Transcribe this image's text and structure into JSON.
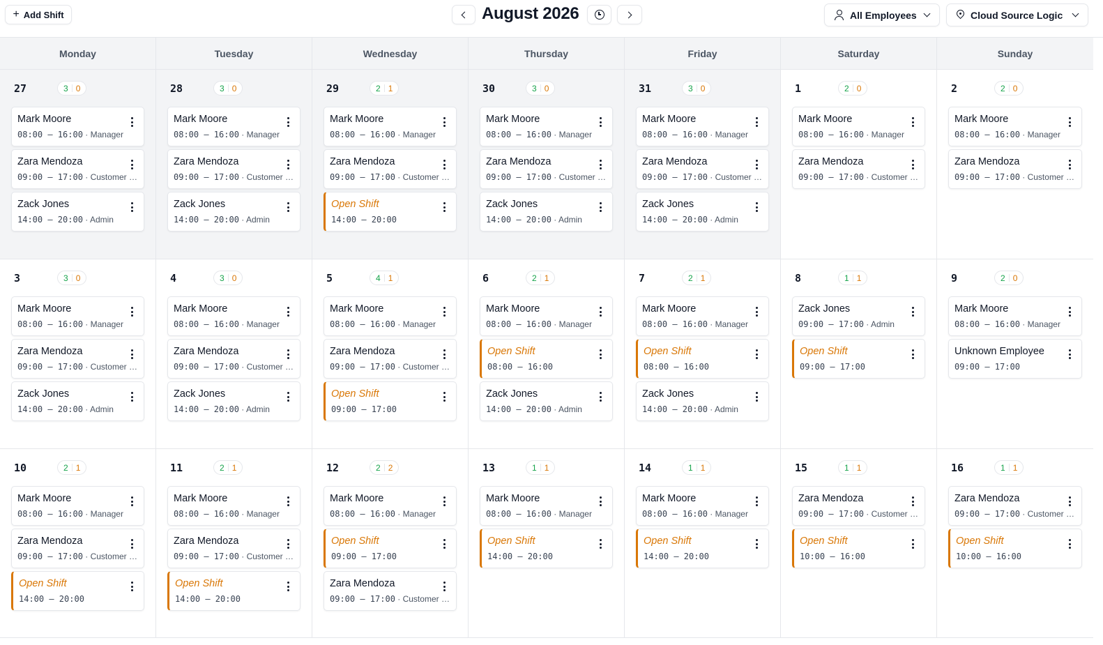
{
  "toolbar": {
    "add_shift_label": "Add Shift",
    "month_title": "August 2026",
    "employee_filter": "All Employees",
    "location_filter": "Cloud Source Logic"
  },
  "weekdays": [
    "Monday",
    "Tuesday",
    "Wednesday",
    "Thursday",
    "Friday",
    "Saturday",
    "Sunday"
  ],
  "colors": {
    "assigned": "#16a34a",
    "open": "#d97706"
  },
  "weeks": [
    [
      {
        "day": "27",
        "outside": true,
        "assigned": "3",
        "open": "0",
        "shifts": [
          {
            "name": "Mark Moore",
            "time": "08:00 – 16:00",
            "role": "Manager"
          },
          {
            "name": "Zara Mendoza",
            "time": "09:00 – 17:00",
            "role": "Customer Support"
          },
          {
            "name": "Zack Jones",
            "time": "14:00 – 20:00",
            "role": "Admin"
          }
        ]
      },
      {
        "day": "28",
        "outside": true,
        "assigned": "3",
        "open": "0",
        "shifts": [
          {
            "name": "Mark Moore",
            "time": "08:00 – 16:00",
            "role": "Manager"
          },
          {
            "name": "Zara Mendoza",
            "time": "09:00 – 17:00",
            "role": "Customer Support"
          },
          {
            "name": "Zack Jones",
            "time": "14:00 – 20:00",
            "role": "Admin"
          }
        ]
      },
      {
        "day": "29",
        "outside": true,
        "assigned": "2",
        "open": "1",
        "shifts": [
          {
            "name": "Mark Moore",
            "time": "08:00 – 16:00",
            "role": "Manager"
          },
          {
            "name": "Zara Mendoza",
            "time": "09:00 – 17:00",
            "role": "Customer Support"
          },
          {
            "name": "Open Shift",
            "time": "14:00 – 20:00",
            "role": "",
            "open": true
          }
        ]
      },
      {
        "day": "30",
        "outside": true,
        "assigned": "3",
        "open": "0",
        "shifts": [
          {
            "name": "Mark Moore",
            "time": "08:00 – 16:00",
            "role": "Manager"
          },
          {
            "name": "Zara Mendoza",
            "time": "09:00 – 17:00",
            "role": "Customer Support"
          },
          {
            "name": "Zack Jones",
            "time": "14:00 – 20:00",
            "role": "Admin"
          }
        ]
      },
      {
        "day": "31",
        "outside": true,
        "assigned": "3",
        "open": "0",
        "shifts": [
          {
            "name": "Mark Moore",
            "time": "08:00 – 16:00",
            "role": "Manager"
          },
          {
            "name": "Zara Mendoza",
            "time": "09:00 – 17:00",
            "role": "Customer Support"
          },
          {
            "name": "Zack Jones",
            "time": "14:00 – 20:00",
            "role": "Admin"
          }
        ]
      },
      {
        "day": "1",
        "outside": false,
        "assigned": "2",
        "open": "0",
        "shifts": [
          {
            "name": "Mark Moore",
            "time": "08:00 – 16:00",
            "role": "Manager"
          },
          {
            "name": "Zara Mendoza",
            "time": "09:00 – 17:00",
            "role": "Customer Support"
          }
        ]
      },
      {
        "day": "2",
        "outside": false,
        "assigned": "2",
        "open": "0",
        "shifts": [
          {
            "name": "Mark Moore",
            "time": "08:00 – 16:00",
            "role": "Manager"
          },
          {
            "name": "Zara Mendoza",
            "time": "09:00 – 17:00",
            "role": "Customer Support"
          }
        ]
      }
    ],
    [
      {
        "day": "3",
        "outside": false,
        "assigned": "3",
        "open": "0",
        "shifts": [
          {
            "name": "Mark Moore",
            "time": "08:00 – 16:00",
            "role": "Manager"
          },
          {
            "name": "Zara Mendoza",
            "time": "09:00 – 17:00",
            "role": "Customer Support"
          },
          {
            "name": "Zack Jones",
            "time": "14:00 – 20:00",
            "role": "Admin"
          }
        ]
      },
      {
        "day": "4",
        "outside": false,
        "assigned": "3",
        "open": "0",
        "shifts": [
          {
            "name": "Mark Moore",
            "time": "08:00 – 16:00",
            "role": "Manager"
          },
          {
            "name": "Zara Mendoza",
            "time": "09:00 – 17:00",
            "role": "Customer Support"
          },
          {
            "name": "Zack Jones",
            "time": "14:00 – 20:00",
            "role": "Admin"
          }
        ]
      },
      {
        "day": "5",
        "outside": false,
        "assigned": "4",
        "open": "1",
        "shifts": [
          {
            "name": "Mark Moore",
            "time": "08:00 – 16:00",
            "role": "Manager"
          },
          {
            "name": "Zara Mendoza",
            "time": "09:00 – 17:00",
            "role": "Customer Support"
          },
          {
            "name": "Open Shift",
            "time": "09:00 – 17:00",
            "role": "",
            "open": true
          }
        ]
      },
      {
        "day": "6",
        "outside": false,
        "assigned": "2",
        "open": "1",
        "shifts": [
          {
            "name": "Mark Moore",
            "time": "08:00 – 16:00",
            "role": "Manager"
          },
          {
            "name": "Open Shift",
            "time": "08:00 – 16:00",
            "role": "",
            "open": true
          },
          {
            "name": "Zack Jones",
            "time": "14:00 – 20:00",
            "role": "Admin"
          }
        ]
      },
      {
        "day": "7",
        "outside": false,
        "assigned": "2",
        "open": "1",
        "shifts": [
          {
            "name": "Mark Moore",
            "time": "08:00 – 16:00",
            "role": "Manager"
          },
          {
            "name": "Open Shift",
            "time": "08:00 – 16:00",
            "role": "",
            "open": true
          },
          {
            "name": "Zack Jones",
            "time": "14:00 – 20:00",
            "role": "Admin"
          }
        ]
      },
      {
        "day": "8",
        "outside": false,
        "assigned": "1",
        "open": "1",
        "shifts": [
          {
            "name": "Zack Jones",
            "time": "09:00 – 17:00",
            "role": "Admin"
          },
          {
            "name": "Open Shift",
            "time": "09:00 – 17:00",
            "role": "",
            "open": true
          }
        ]
      },
      {
        "day": "9",
        "outside": false,
        "assigned": "2",
        "open": "0",
        "shifts": [
          {
            "name": "Mark Moore",
            "time": "08:00 – 16:00",
            "role": "Manager"
          },
          {
            "name": "Unknown Employee",
            "time": "09:00 – 17:00",
            "role": ""
          }
        ]
      }
    ],
    [
      {
        "day": "10",
        "outside": false,
        "assigned": "2",
        "open": "1",
        "shifts": [
          {
            "name": "Mark Moore",
            "time": "08:00 – 16:00",
            "role": "Manager"
          },
          {
            "name": "Zara Mendoza",
            "time": "09:00 – 17:00",
            "role": "Customer Support"
          },
          {
            "name": "Open Shift",
            "time": "14:00 – 20:00",
            "role": "",
            "open": true
          }
        ]
      },
      {
        "day": "11",
        "outside": false,
        "assigned": "2",
        "open": "1",
        "shifts": [
          {
            "name": "Mark Moore",
            "time": "08:00 – 16:00",
            "role": "Manager"
          },
          {
            "name": "Zara Mendoza",
            "time": "09:00 – 17:00",
            "role": "Customer Support"
          },
          {
            "name": "Open Shift",
            "time": "14:00 – 20:00",
            "role": "",
            "open": true
          }
        ]
      },
      {
        "day": "12",
        "outside": false,
        "assigned": "2",
        "open": "2",
        "shifts": [
          {
            "name": "Mark Moore",
            "time": "08:00 – 16:00",
            "role": "Manager"
          },
          {
            "name": "Open Shift",
            "time": "09:00 – 17:00",
            "role": "",
            "open": true
          },
          {
            "name": "Zara Mendoza",
            "time": "09:00 – 17:00",
            "role": "Customer Support"
          }
        ]
      },
      {
        "day": "13",
        "outside": false,
        "assigned": "1",
        "open": "1",
        "shifts": [
          {
            "name": "Mark Moore",
            "time": "08:00 – 16:00",
            "role": "Manager"
          },
          {
            "name": "Open Shift",
            "time": "14:00 – 20:00",
            "role": "",
            "open": true
          }
        ]
      },
      {
        "day": "14",
        "outside": false,
        "assigned": "1",
        "open": "1",
        "shifts": [
          {
            "name": "Mark Moore",
            "time": "08:00 – 16:00",
            "role": "Manager"
          },
          {
            "name": "Open Shift",
            "time": "14:00 – 20:00",
            "role": "",
            "open": true
          }
        ]
      },
      {
        "day": "15",
        "outside": false,
        "assigned": "1",
        "open": "1",
        "shifts": [
          {
            "name": "Zara Mendoza",
            "time": "09:00 – 17:00",
            "role": "Customer Support"
          },
          {
            "name": "Open Shift",
            "time": "10:00 – 16:00",
            "role": "",
            "open": true
          }
        ]
      },
      {
        "day": "16",
        "outside": false,
        "assigned": "1",
        "open": "1",
        "shifts": [
          {
            "name": "Zara Mendoza",
            "time": "09:00 – 17:00",
            "role": "Customer Support"
          },
          {
            "name": "Open Shift",
            "time": "10:00 – 16:00",
            "role": "",
            "open": true
          }
        ]
      }
    ]
  ]
}
